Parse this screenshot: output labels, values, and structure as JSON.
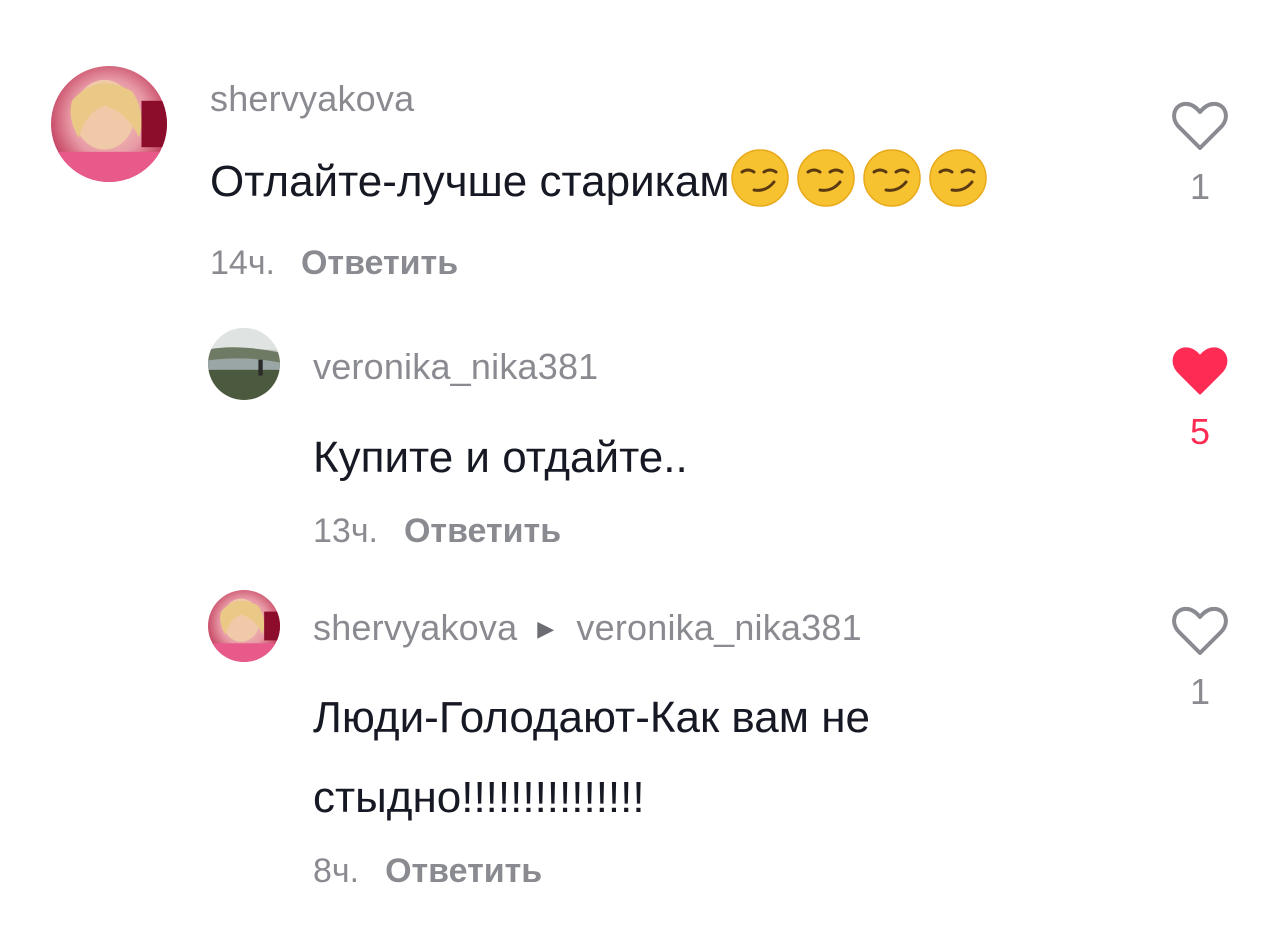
{
  "comments": [
    {
      "username": "shervyakova",
      "text": "Отлайте-лучше старикам",
      "emoji_count": 4,
      "time": "14ч.",
      "reply_label": "Ответить",
      "likes": "1",
      "liked": false
    },
    {
      "username": "veronika_nika381",
      "text": "Купите и отдайте..",
      "time": "13ч.",
      "reply_label": "Ответить",
      "likes": "5",
      "liked": true
    },
    {
      "username": "shervyakova",
      "reply_to": "veronika_nika381",
      "text_line1": "Люди-Голодают-Как вам не",
      "text_line2": "стыдно!!!!!!!!!!!!!!!",
      "time": "8ч.",
      "reply_label": "Ответить",
      "likes": "1",
      "liked": false
    }
  ],
  "icons": {
    "heart_outline": "heart-outline-icon",
    "heart_filled": "heart-filled-icon",
    "reply_arrow": "reply-arrow-icon",
    "emoji": "smirking-face-emoji"
  },
  "colors": {
    "text_primary": "#161823",
    "text_secondary": "#8a8b91",
    "like_active": "#fe2c55"
  }
}
